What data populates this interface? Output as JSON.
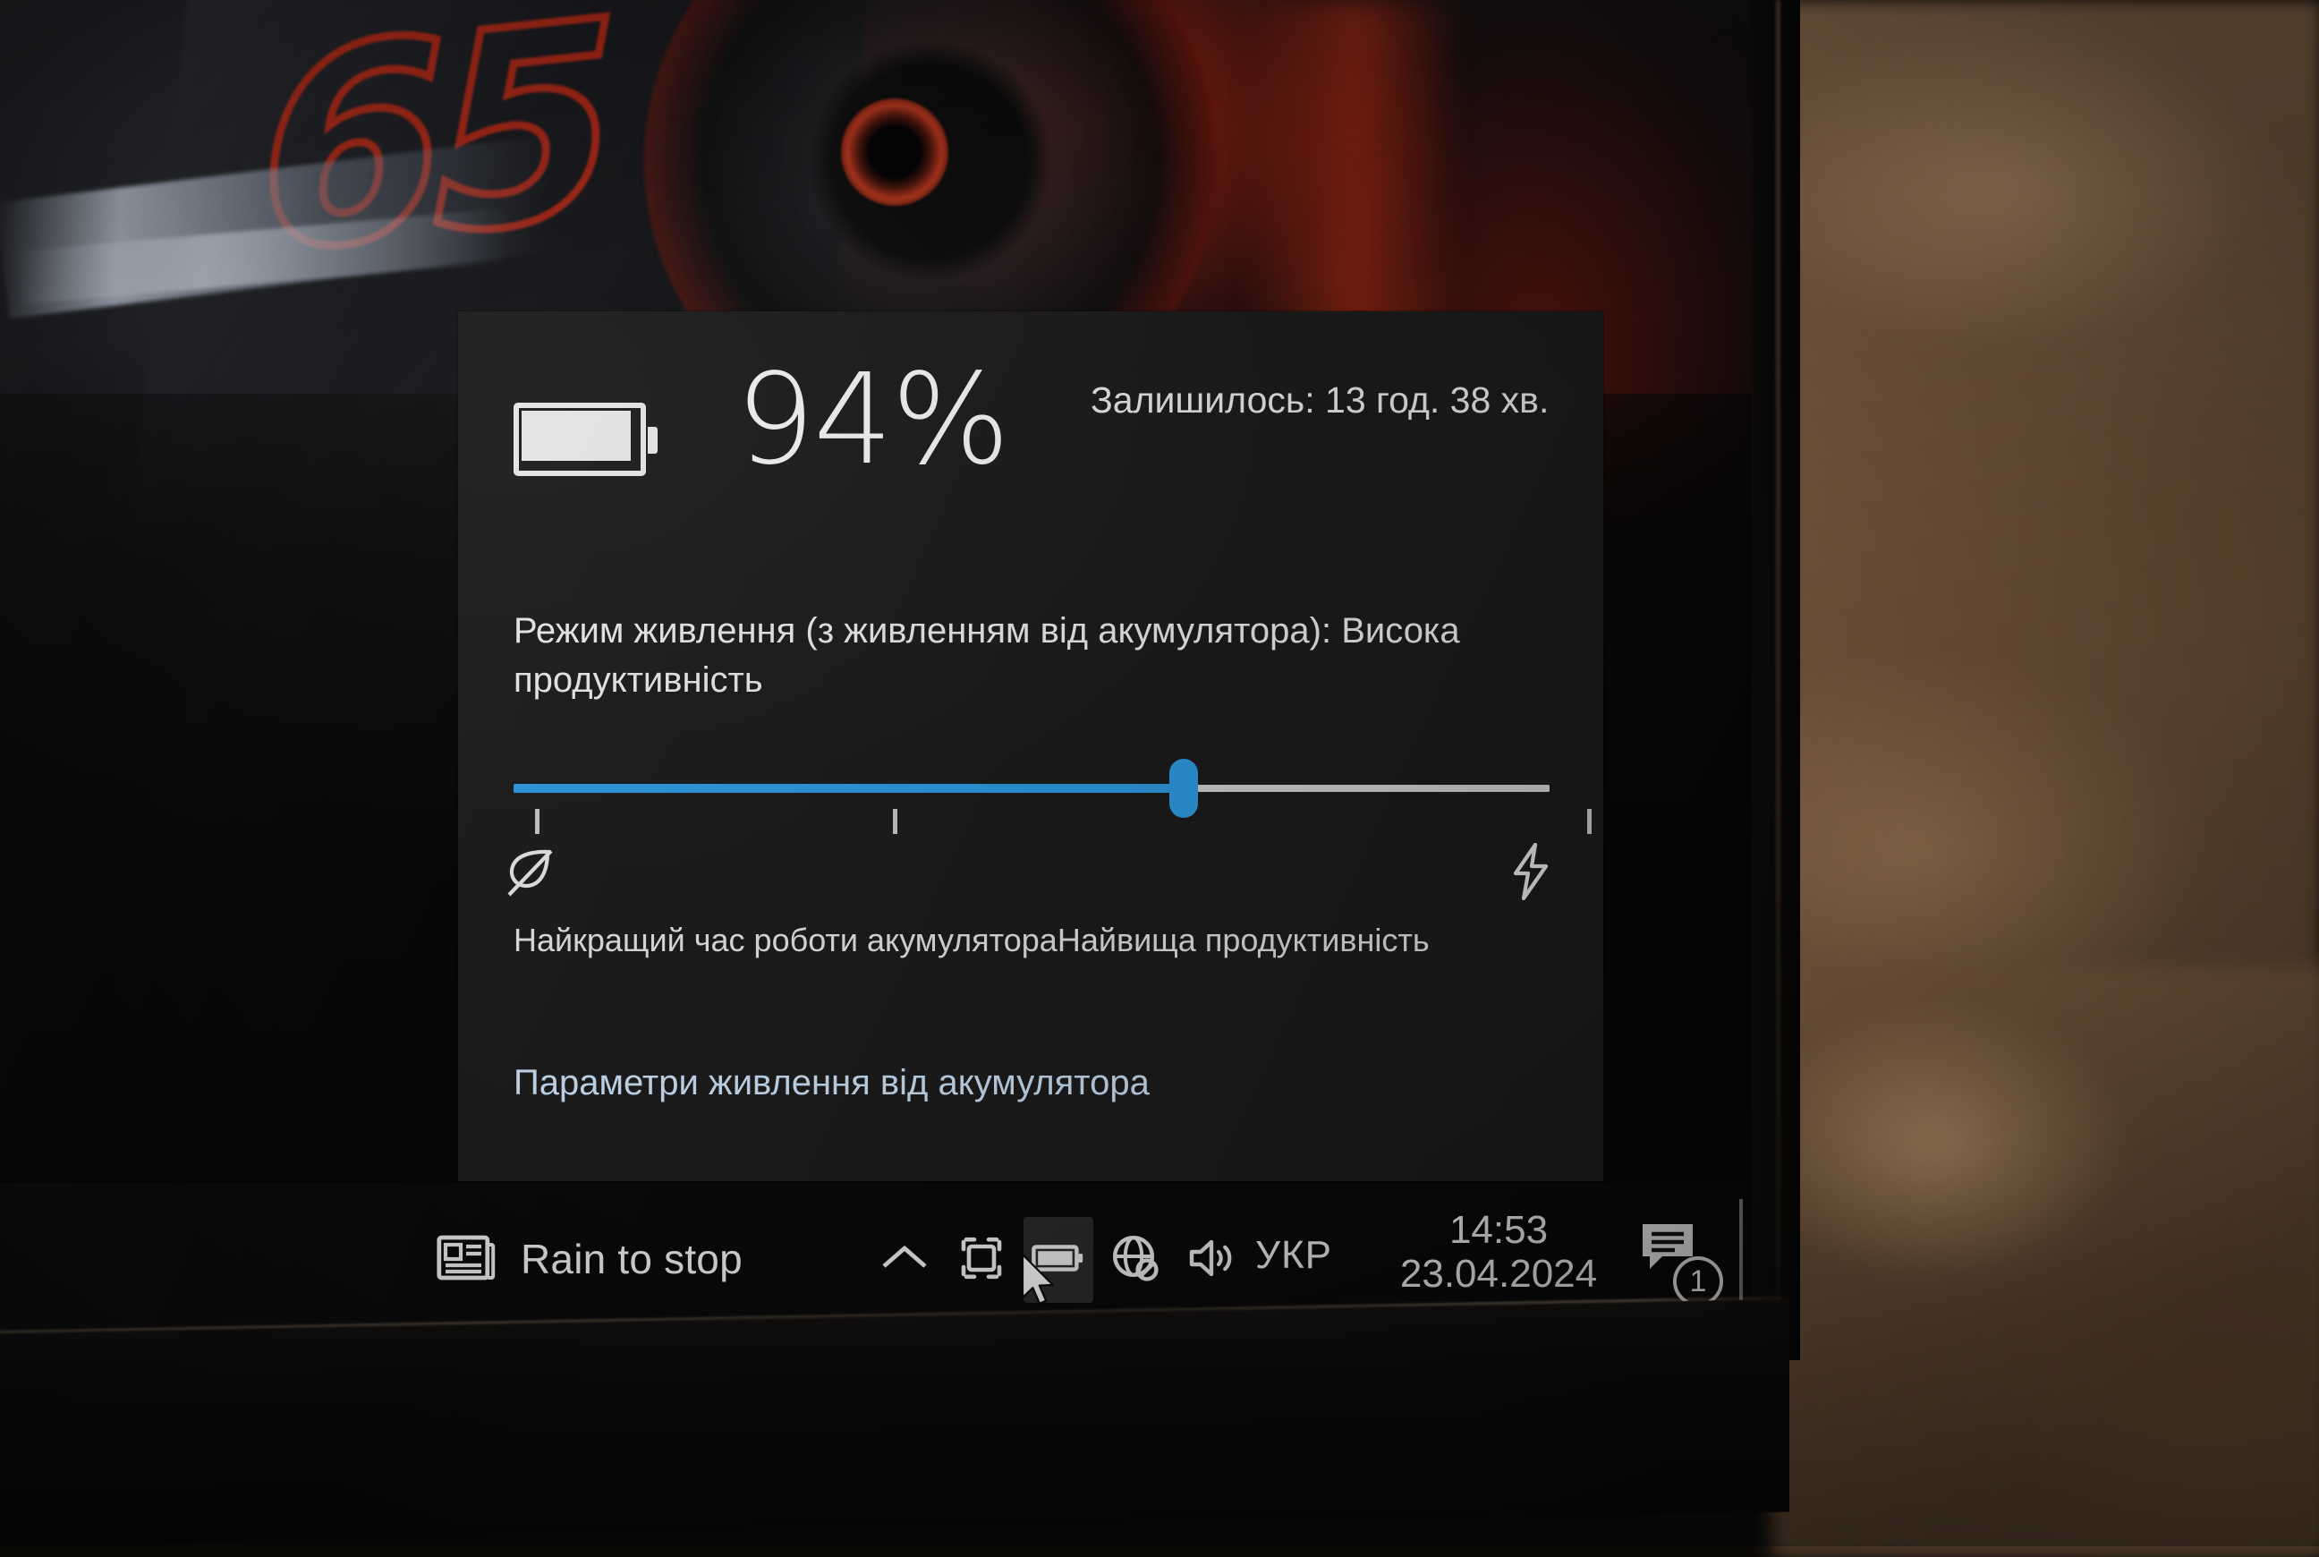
{
  "flyout": {
    "battery_icon": "battery-full-icon",
    "percent": "94%",
    "remaining": "Залишилось: 13 год. 38 хв.",
    "power_mode_label": "Режим живлення (з живленням від акумулятора): Висока продуктивність",
    "slider": {
      "value_percent": 64,
      "left_icon": "leaf-icon",
      "right_icon": "lightning-bolt-icon",
      "endpoint_labels": "Найкращий час роботи акумулятораНайвища продуктивність",
      "left_endpoint": "Найкращий час роботи акумулятора",
      "right_endpoint": "Найвища продуктивність",
      "fill_color": "#2f9fe8",
      "track_color": "#d8d8d8"
    },
    "settings_link": "Параметри живлення від акумулятора",
    "link_color": "#cfe6fb",
    "background_color": "#1d1d1d"
  },
  "taskbar": {
    "news": {
      "icon": "news-widget-icon",
      "label": "Rain to stop"
    },
    "overflow_icon": "chevron-up-icon",
    "tray_icons": [
      {
        "name": "display-cast-icon",
        "hovered": false
      },
      {
        "name": "battery-icon",
        "hovered": true
      },
      {
        "name": "network-disconnected-icon",
        "hovered": false
      },
      {
        "name": "volume-icon",
        "hovered": false
      }
    ],
    "language": "УКР",
    "clock": {
      "time": "14:53",
      "date": "23.04.2024"
    },
    "notifications": {
      "icon": "notification-center-icon",
      "badge": "1"
    },
    "background_color": "#0a0a0a"
  },
  "desktop": {
    "wallpaper_text": "65"
  }
}
